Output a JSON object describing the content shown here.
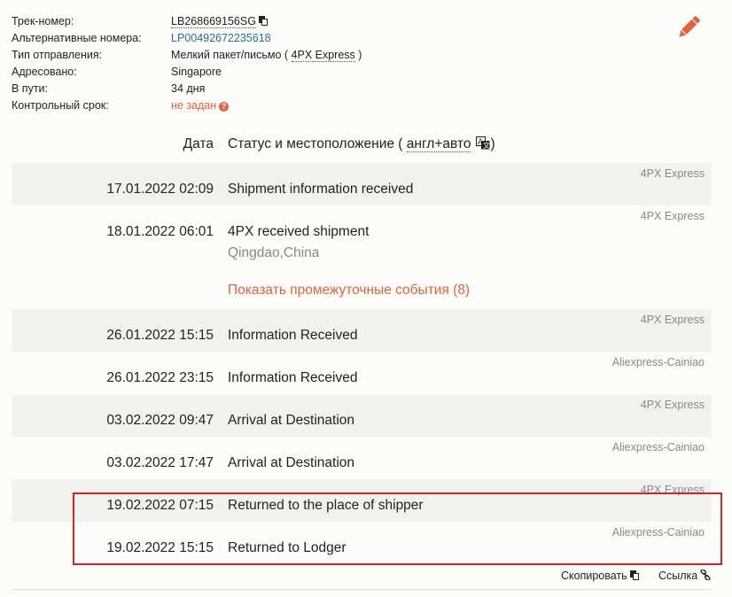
{
  "info": {
    "tracking_label": "Трек-номер:",
    "tracking_value": "LB268669156SG",
    "alt_label": "Альтернативные номера:",
    "alt_value": "LP00492672235618",
    "type_label": "Тип отправления:",
    "type_value_prefix": "Мелкий пакет/письмо (",
    "type_value_carrier": "4PX Express",
    "type_value_suffix": ")",
    "dest_label": "Адресовано:",
    "dest_value": "Singapore",
    "transit_label": "В пути:",
    "transit_value": "34 дня",
    "deadline_label": "Контрольный срок:",
    "deadline_value": "не задан"
  },
  "header": {
    "date": "Дата",
    "status_prefix": "Статус и местоположение (",
    "status_lang": "англ+авто",
    "status_suffix": ")"
  },
  "events": [
    {
      "carrier": "4PX Express",
      "date": "17.01.2022 02:09",
      "status": "Shipment information received",
      "location": ""
    },
    {
      "carrier": "4PX Express",
      "date": "18.01.2022 06:01",
      "status": "4PX received shipment",
      "location": "Qingdao,China"
    },
    {
      "carrier": "4PX Express",
      "date": "26.01.2022 15:15",
      "status": "Information Received",
      "location": ""
    },
    {
      "carrier": "Aliexpress-Cainiao",
      "date": "26.01.2022 23:15",
      "status": "Information Received",
      "location": ""
    },
    {
      "carrier": "4PX Express",
      "date": "03.02.2022 09:47",
      "status": "Arrival at Destination",
      "location": ""
    },
    {
      "carrier": "Aliexpress-Cainiao",
      "date": "03.02.2022 17:47",
      "status": "Arrival at Destination",
      "location": ""
    },
    {
      "carrier": "4PX Express",
      "date": "19.02.2022 07:15",
      "status": "Returned to the place of shipper",
      "location": ""
    },
    {
      "carrier": "Aliexpress-Cainiao",
      "date": "19.02.2022 15:15",
      "status": "Returned to Lodger",
      "location": ""
    }
  ],
  "show_events": "Показать промежуточные события (8)",
  "footer": {
    "copy": "Скопировать",
    "link": "Ссылка"
  },
  "colors": {
    "accent": "#e4633f",
    "link": "#2a6e9a",
    "highlight": "#d1242b"
  },
  "icons": [
    "copy-icon",
    "question-icon",
    "pencil-icon",
    "translate-icon",
    "link-icon"
  ]
}
